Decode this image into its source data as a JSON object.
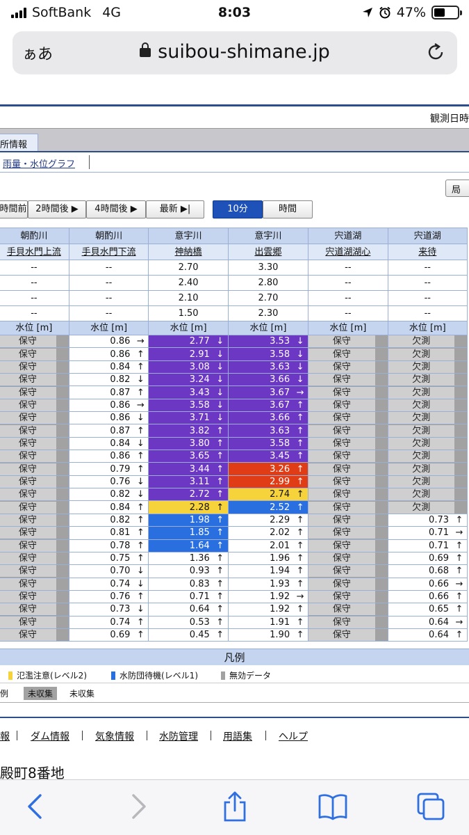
{
  "status_bar": {
    "carrier": "SoftBank",
    "network": "4G",
    "time": "8:03",
    "battery": "47%",
    "battery_level": 0.47
  },
  "url_bar": {
    "aa_label": "ぁあ",
    "domain": "suibou-shimane.jp"
  },
  "page": {
    "observed_label": "観測日時",
    "tab_label": "所情報",
    "sub_link": "雨量・水位グラフ",
    "local_button": "局",
    "nav_buttons": [
      "時間前",
      "2時間後 ▶",
      "4時間後 ▶",
      "最新 ▶|"
    ],
    "interval_buttons": [
      "10分",
      "時間"
    ],
    "active_interval": "10分"
  },
  "table": {
    "rivers": [
      "朝酌川",
      "朝酌川",
      "意宇川",
      "意宇川",
      "宍道湖",
      "宍道湖"
    ],
    "stations": [
      "手貝水門上流",
      "手貝水門下流",
      "神納橋",
      "出雲郷",
      "宍道湖湖心",
      "来待"
    ],
    "thresholds": [
      [
        "--",
        "--",
        "2.70",
        "3.30",
        "--",
        "--"
      ],
      [
        "--",
        "--",
        "2.40",
        "2.80",
        "--",
        "--"
      ],
      [
        "--",
        "--",
        "2.10",
        "2.70",
        "--",
        "--"
      ],
      [
        "--",
        "--",
        "1.50",
        "2.30",
        "--",
        "--"
      ]
    ],
    "unit_label": "水位 [m]",
    "rows": [
      [
        [
          "保守",
          "",
          "g"
        ],
        [
          "0.86",
          "→",
          "w"
        ],
        [
          "2.77",
          "↓",
          "p"
        ],
        [
          "3.53",
          "↓",
          "p"
        ],
        [
          "保守",
          "",
          "g"
        ],
        [
          "欠測",
          "",
          "g"
        ]
      ],
      [
        [
          "保守",
          "",
          "g"
        ],
        [
          "0.86",
          "↑",
          "w"
        ],
        [
          "2.91",
          "↓",
          "p"
        ],
        [
          "3.58",
          "↓",
          "p"
        ],
        [
          "保守",
          "",
          "g"
        ],
        [
          "欠測",
          "",
          "g"
        ]
      ],
      [
        [
          "保守",
          "",
          "g"
        ],
        [
          "0.84",
          "↑",
          "w"
        ],
        [
          "3.08",
          "↓",
          "p"
        ],
        [
          "3.63",
          "↓",
          "p"
        ],
        [
          "保守",
          "",
          "g"
        ],
        [
          "欠測",
          "",
          "g"
        ]
      ],
      [
        [
          "保守",
          "",
          "g"
        ],
        [
          "0.82",
          "↓",
          "w"
        ],
        [
          "3.24",
          "↓",
          "p"
        ],
        [
          "3.66",
          "↓",
          "p"
        ],
        [
          "保守",
          "",
          "g"
        ],
        [
          "欠測",
          "",
          "g"
        ]
      ],
      [
        [
          "保守",
          "",
          "g"
        ],
        [
          "0.87",
          "↑",
          "w"
        ],
        [
          "3.43",
          "↓",
          "p"
        ],
        [
          "3.67",
          "→",
          "p"
        ],
        [
          "保守",
          "",
          "g"
        ],
        [
          "欠測",
          "",
          "g"
        ]
      ],
      [
        [
          "保守",
          "",
          "g"
        ],
        [
          "0.86",
          "→",
          "w"
        ],
        [
          "3.58",
          "↓",
          "p"
        ],
        [
          "3.67",
          "↑",
          "p"
        ],
        [
          "保守",
          "",
          "g"
        ],
        [
          "欠測",
          "",
          "g"
        ]
      ],
      [
        [
          "保守",
          "",
          "g"
        ],
        [
          "0.86",
          "↓",
          "w"
        ],
        [
          "3.71",
          "↓",
          "p"
        ],
        [
          "3.66",
          "↑",
          "p"
        ],
        [
          "保守",
          "",
          "g"
        ],
        [
          "欠測",
          "",
          "g"
        ]
      ],
      [
        [
          "保守",
          "",
          "g"
        ],
        [
          "0.87",
          "↑",
          "w"
        ],
        [
          "3.82",
          "↑",
          "p"
        ],
        [
          "3.63",
          "↑",
          "p"
        ],
        [
          "保守",
          "",
          "g"
        ],
        [
          "欠測",
          "",
          "g"
        ]
      ],
      [
        [
          "保守",
          "",
          "g"
        ],
        [
          "0.84",
          "↓",
          "w"
        ],
        [
          "3.80",
          "↑",
          "p"
        ],
        [
          "3.58",
          "↑",
          "p"
        ],
        [
          "保守",
          "",
          "g"
        ],
        [
          "欠測",
          "",
          "g"
        ]
      ],
      [
        [
          "保守",
          "",
          "g"
        ],
        [
          "0.86",
          "↑",
          "w"
        ],
        [
          "3.65",
          "↑",
          "p"
        ],
        [
          "3.45",
          "↑",
          "p"
        ],
        [
          "保守",
          "",
          "g"
        ],
        [
          "欠測",
          "",
          "g"
        ]
      ],
      [
        [
          "保守",
          "",
          "g"
        ],
        [
          "0.79",
          "↑",
          "w"
        ],
        [
          "3.44",
          "↑",
          "p"
        ],
        [
          "3.26",
          "↑",
          "r"
        ],
        [
          "保守",
          "",
          "g"
        ],
        [
          "欠測",
          "",
          "g"
        ]
      ],
      [
        [
          "保守",
          "",
          "g"
        ],
        [
          "0.76",
          "↓",
          "w"
        ],
        [
          "3.11",
          "↑",
          "p"
        ],
        [
          "2.99",
          "↑",
          "r"
        ],
        [
          "保守",
          "",
          "g"
        ],
        [
          "欠測",
          "",
          "g"
        ]
      ],
      [
        [
          "保守",
          "",
          "g"
        ],
        [
          "0.82",
          "↓",
          "w"
        ],
        [
          "2.72",
          "↑",
          "p"
        ],
        [
          "2.74",
          "↑",
          "y"
        ],
        [
          "保守",
          "",
          "g"
        ],
        [
          "欠測",
          "",
          "g"
        ]
      ],
      [
        [
          "保守",
          "",
          "g"
        ],
        [
          "0.84",
          "↑",
          "w"
        ],
        [
          "2.28",
          "↑",
          "y"
        ],
        [
          "2.52",
          "↑",
          "b"
        ],
        [
          "保守",
          "",
          "g"
        ],
        [
          "欠測",
          "",
          "g"
        ]
      ],
      [
        [
          "保守",
          "",
          "g"
        ],
        [
          "0.82",
          "↑",
          "w"
        ],
        [
          "1.98",
          "↑",
          "b"
        ],
        [
          "2.29",
          "↑",
          "w"
        ],
        [
          "保守",
          "",
          "g"
        ],
        [
          "0.73",
          "↑",
          "w"
        ]
      ],
      [
        [
          "保守",
          "",
          "g"
        ],
        [
          "0.81",
          "↑",
          "w"
        ],
        [
          "1.85",
          "↑",
          "b"
        ],
        [
          "2.02",
          "↑",
          "w"
        ],
        [
          "保守",
          "",
          "g"
        ],
        [
          "0.71",
          "→",
          "w"
        ]
      ],
      [
        [
          "保守",
          "",
          "g"
        ],
        [
          "0.78",
          "↑",
          "w"
        ],
        [
          "1.64",
          "↑",
          "b"
        ],
        [
          "2.01",
          "↑",
          "w"
        ],
        [
          "保守",
          "",
          "g"
        ],
        [
          "0.71",
          "↑",
          "w"
        ]
      ],
      [
        [
          "保守",
          "",
          "g"
        ],
        [
          "0.75",
          "↑",
          "w"
        ],
        [
          "1.36",
          "↑",
          "w"
        ],
        [
          "1.96",
          "↑",
          "w"
        ],
        [
          "保守",
          "",
          "g"
        ],
        [
          "0.69",
          "↑",
          "w"
        ]
      ],
      [
        [
          "保守",
          "",
          "g"
        ],
        [
          "0.70",
          "↓",
          "w"
        ],
        [
          "0.93",
          "↑",
          "w"
        ],
        [
          "1.94",
          "↑",
          "w"
        ],
        [
          "保守",
          "",
          "g"
        ],
        [
          "0.68",
          "↑",
          "w"
        ]
      ],
      [
        [
          "保守",
          "",
          "g"
        ],
        [
          "0.74",
          "↓",
          "w"
        ],
        [
          "0.83",
          "↑",
          "w"
        ],
        [
          "1.93",
          "↑",
          "w"
        ],
        [
          "保守",
          "",
          "g"
        ],
        [
          "0.66",
          "→",
          "w"
        ]
      ],
      [
        [
          "保守",
          "",
          "g"
        ],
        [
          "0.76",
          "↑",
          "w"
        ],
        [
          "0.71",
          "↑",
          "w"
        ],
        [
          "1.92",
          "→",
          "w"
        ],
        [
          "保守",
          "",
          "g"
        ],
        [
          "0.66",
          "↑",
          "w"
        ]
      ],
      [
        [
          "保守",
          "",
          "g"
        ],
        [
          "0.73",
          "↓",
          "w"
        ],
        [
          "0.64",
          "↑",
          "w"
        ],
        [
          "1.92",
          "↑",
          "w"
        ],
        [
          "保守",
          "",
          "g"
        ],
        [
          "0.65",
          "↑",
          "w"
        ]
      ],
      [
        [
          "保守",
          "",
          "g"
        ],
        [
          "0.74",
          "↑",
          "w"
        ],
        [
          "0.53",
          "↑",
          "w"
        ],
        [
          "1.91",
          "↑",
          "w"
        ],
        [
          "保守",
          "",
          "g"
        ],
        [
          "0.64",
          "→",
          "w"
        ]
      ],
      [
        [
          "保守",
          "",
          "g"
        ],
        [
          "0.69",
          "↑",
          "w"
        ],
        [
          "0.45",
          "↑",
          "w"
        ],
        [
          "1.90",
          "↑",
          "w"
        ],
        [
          "保守",
          "",
          "g"
        ],
        [
          "0.64",
          "↑",
          "w"
        ]
      ]
    ]
  },
  "legend": {
    "title": "凡例",
    "items": [
      {
        "label": "氾濫注意(レベル2)",
        "color": "#f6d33a"
      },
      {
        "label": "水防団待機(レベル1)",
        "color": "#2a6fe0"
      },
      {
        "label": "無効データ",
        "color": "#a2a2a2"
      }
    ],
    "row2_prefix": "例",
    "unreceived_badge": "未収集",
    "unreceived_label": "未収集"
  },
  "footer": {
    "links": [
      "報",
      "ダム情報",
      "気象情報",
      "水防管理",
      "用語集",
      "ヘルプ"
    ],
    "address": "殿町8番地"
  },
  "colors": {
    "accent": "#2c4d8a",
    "purple": "#6c37c2",
    "red": "#e03d17",
    "yellow": "#f6d33a",
    "blue": "#2a6fe0",
    "gray": "#a2a2a2"
  }
}
